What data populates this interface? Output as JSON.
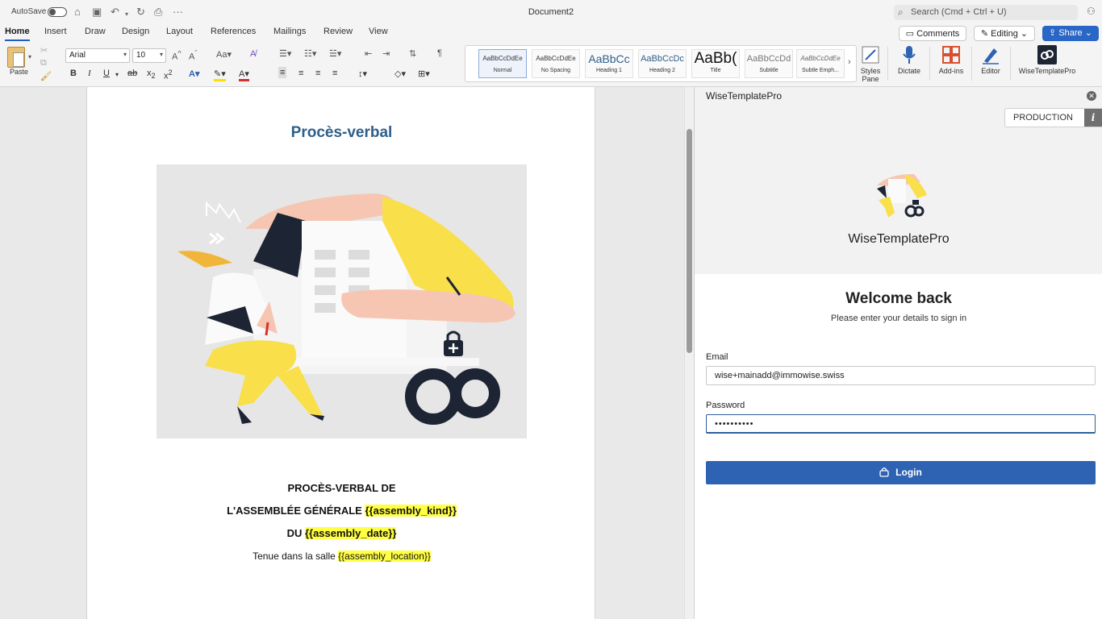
{
  "titlebar": {
    "autosave_label": "AutoSave",
    "document_title": "Document2",
    "search_placeholder": "Search (Cmd + Ctrl + U)",
    "icons": [
      "home-icon",
      "save-icon",
      "undo-icon",
      "redo-icon",
      "print-icon",
      "more-icon"
    ]
  },
  "tabs": [
    "Home",
    "Insert",
    "Draw",
    "Design",
    "Layout",
    "References",
    "Mailings",
    "Review",
    "View"
  ],
  "active_tab": "Home",
  "actions": {
    "comments": "Comments",
    "editing": "Editing",
    "share": "Share"
  },
  "ribbon": {
    "paste_label": "Paste",
    "font_name": "Arial",
    "font_size": "10",
    "styles": [
      {
        "sample": "AaBbCcDdEe",
        "name": "Normal"
      },
      {
        "sample": "AaBbCcDdEe",
        "name": "No Spacing"
      },
      {
        "sample": "AaBbCc",
        "name": "Heading 1"
      },
      {
        "sample": "AaBbCcDc",
        "name": "Heading 2"
      },
      {
        "sample": "AaBb(",
        "name": "Title"
      },
      {
        "sample": "AaBbCcDd",
        "name": "Subtitle"
      },
      {
        "sample": "AaBbCcDdEe",
        "name": "Subtle Emph..."
      }
    ],
    "styles_pane_label": "Styles Pane",
    "dictate_label": "Dictate",
    "addins_label": "Add-ins",
    "editor_label": "Editor",
    "wisetemplate_label": "WiseTemplatePro",
    "colors": {
      "highlight": "#ffde00",
      "font_color": "#d32f2f"
    }
  },
  "document": {
    "title": "Procès-verbal",
    "line1": "PROCÈS-VERBAL DE",
    "line2_text": "L'ASSEMBLÉE GÉNÉRALE ",
    "line2_field": "{{assembly_kind}}",
    "line3_text": "DU ",
    "line3_field": "{{assembly_date}}",
    "line4_text": "Tenue dans la salle ",
    "line4_field": "{{assembly_location}}"
  },
  "pane": {
    "title": "WiseTemplatePro",
    "environment": "PRODUCTION",
    "info_icon": "i",
    "brand_name": "WiseTemplatePro",
    "welcome": "Welcome back",
    "subtitle": "Please enter your details to sign in",
    "email_label": "Email",
    "email_value": "wise+mainadd@immowise.swiss",
    "password_label": "Password",
    "password_value": "••••••••••",
    "login_label": "Login",
    "accent_color": "#2e62b3"
  }
}
